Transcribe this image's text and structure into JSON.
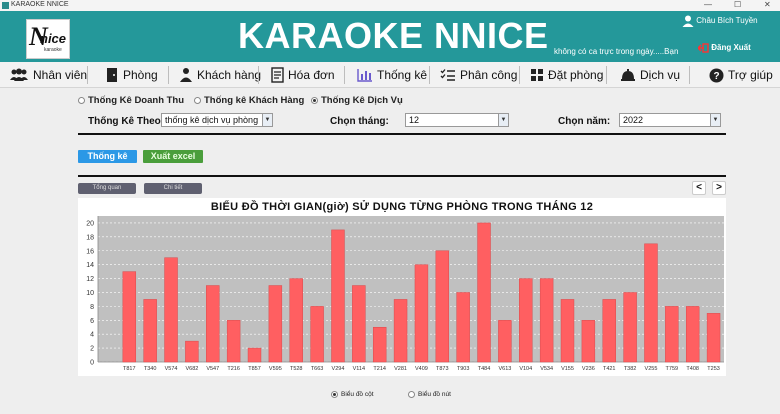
{
  "window": {
    "title": "KARAOKE NNICE",
    "controls": [
      "—",
      "☐",
      "✕"
    ]
  },
  "header": {
    "logo_big": "N",
    "logo_small": "nice",
    "logo_tiny": "karaoke",
    "title": "KARAOKE NNICE",
    "marquee": "không có ca trực trong ngày.....Bạn",
    "user_name": "Châu Bích Tuyền",
    "logout_label": "Đăng Xuất"
  },
  "nav": {
    "items": [
      {
        "label": "Nhân viên",
        "icon": "users-icon"
      },
      {
        "label": "Phòng",
        "icon": "door-icon"
      },
      {
        "label": "Khách hàng",
        "icon": "customer-icon"
      },
      {
        "label": "Hóa đơn",
        "icon": "invoice-icon"
      },
      {
        "label": "Thống kê",
        "icon": "bar-chart-icon"
      },
      {
        "label": "Phân công",
        "icon": "checklist-icon"
      },
      {
        "label": "Đặt phòng",
        "icon": "grid-icon"
      },
      {
        "label": "Dịch vụ",
        "icon": "service-bell-icon"
      },
      {
        "label": "Trợ giúp",
        "icon": "help-icon"
      }
    ]
  },
  "report_types": {
    "options": [
      "Thống Kê Doanh Thu",
      "Thống kê Khách Hàng",
      "Thống Kê Dịch Vụ"
    ],
    "selected_index": 2
  },
  "filters": {
    "by_label": "Thống Kê Theo:",
    "by_value": "thống kê dịch vụ phòng",
    "month_label": "Chọn tháng:",
    "month_value": "12",
    "year_label": "Chọn năm:",
    "year_value": "2022"
  },
  "actions": {
    "stats_label": "Thống kê",
    "excel_label": "Xuất excel"
  },
  "view_tabs": {
    "overview": "Tổng quan",
    "detail": "Chi tiết"
  },
  "pager": {
    "prev": "<",
    "next": ">"
  },
  "colors": {
    "header": "#24989a",
    "bar": "#ff5f61",
    "accent_blue": "#2b98e6",
    "accent_green": "#4a9e3b"
  },
  "chart_data": {
    "type": "bar",
    "title": "BIỂU ĐỒ THỜI GIAN(giờ) SỬ DỤNG TỪNG PHÒNG TRONG THÁNG 12",
    "xlabel": "",
    "ylabel": "",
    "ylim": [
      0,
      21
    ],
    "yticks": [
      0,
      2,
      4,
      6,
      8,
      10,
      12,
      14,
      16,
      18,
      20
    ],
    "grid": true,
    "categories": [
      "",
      "T817",
      "T340",
      "V574",
      "V682",
      "V547",
      "T216",
      "T857",
      "V595",
      "T528",
      "T663",
      "V294",
      "V114",
      "T214",
      "V281",
      "V409",
      "T873",
      "T903",
      "T484",
      "V613",
      "V104",
      "V534",
      "V155",
      "V236",
      "T421",
      "T382",
      "V255",
      "T759",
      "T408",
      "T253"
    ],
    "values": [
      0,
      13,
      9,
      15,
      3,
      11,
      6,
      2,
      11,
      12,
      8,
      19,
      11,
      5,
      9,
      14,
      16,
      10,
      20,
      6,
      12,
      12,
      9,
      6,
      9,
      10,
      17,
      8,
      8,
      7
    ]
  },
  "chart_modes": {
    "options": [
      "Biểu đồ cột",
      "Biểu đồ nút"
    ],
    "selected_index": 0
  }
}
